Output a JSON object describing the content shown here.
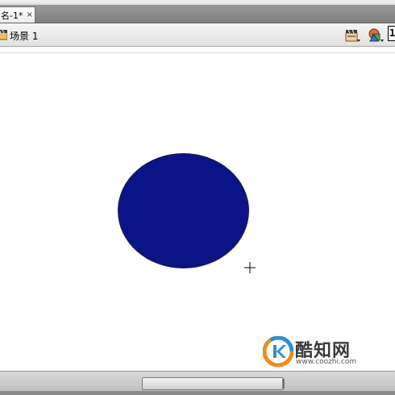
{
  "document_tab": {
    "label": "名-1*",
    "close_glyph": "×"
  },
  "scene_bar": {
    "scene_label": "场景 1",
    "scene_icon": "scene-clapper-icon",
    "edit_scene_icon": "edit-scene-icon",
    "edit_symbol_icon": "edit-symbol-icon",
    "zoom_value": "1"
  },
  "stage": {
    "shape": {
      "type": "oval",
      "fill_color": "#0b1487",
      "stroke_color": "#1d1d3d"
    },
    "cursor_icon": "crosshair-cursor-icon"
  },
  "watermark": {
    "name": "酷知网",
    "url": "www.coozhi.com"
  },
  "colors": {
    "shape_fill": "#0b1487",
    "tab_bar": "#8a8a8a",
    "toolbar": "#ececec"
  }
}
